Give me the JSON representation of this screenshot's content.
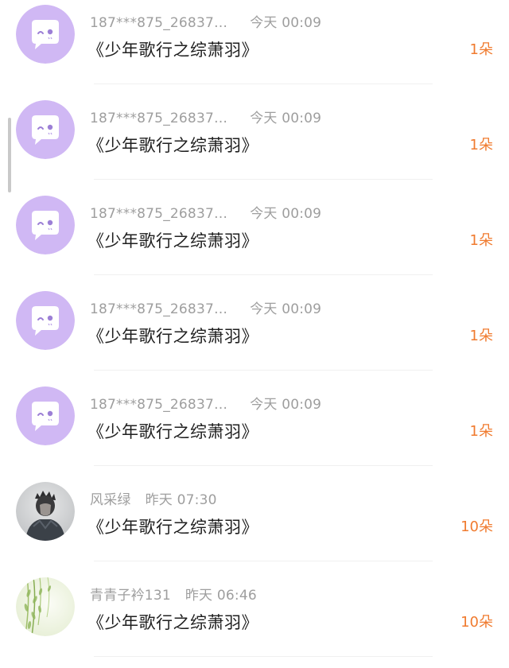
{
  "gifts": [
    {
      "user": "187***875_26837…",
      "time": "今天 00:09",
      "title": "《少年歌行之综萧羽》",
      "count": "1朵",
      "avatar": "default-chat-avatar-icon"
    },
    {
      "user": "187***875_26837…",
      "time": "今天 00:09",
      "title": "《少年歌行之综萧羽》",
      "count": "1朵",
      "avatar": "default-chat-avatar-icon"
    },
    {
      "user": "187***875_26837…",
      "time": "今天 00:09",
      "title": "《少年歌行之综萧羽》",
      "count": "1朵",
      "avatar": "default-chat-avatar-icon"
    },
    {
      "user": "187***875_26837…",
      "time": "今天 00:09",
      "title": "《少年歌行之综萧羽》",
      "count": "1朵",
      "avatar": "default-chat-avatar-icon"
    },
    {
      "user": "187***875_26837…",
      "time": "今天 00:09",
      "title": "《少年歌行之综萧羽》",
      "count": "1朵",
      "avatar": "default-chat-avatar-icon"
    },
    {
      "user": "风采绿",
      "time": "昨天 07:30",
      "title": "《少年歌行之综萧羽》",
      "count": "10朵",
      "avatar": "crowned-figure-avatar"
    },
    {
      "user": "青青子衿131",
      "time": "昨天 06:46",
      "title": "《少年歌行之综萧羽》",
      "count": "10朵",
      "avatar": "willow-branches-avatar"
    }
  ],
  "colors": {
    "default_avatar_bg": "#d0b8f4",
    "count_text": "#f07b2f",
    "meta_text": "#9e9e9e",
    "title_text": "#1f1f1f"
  }
}
